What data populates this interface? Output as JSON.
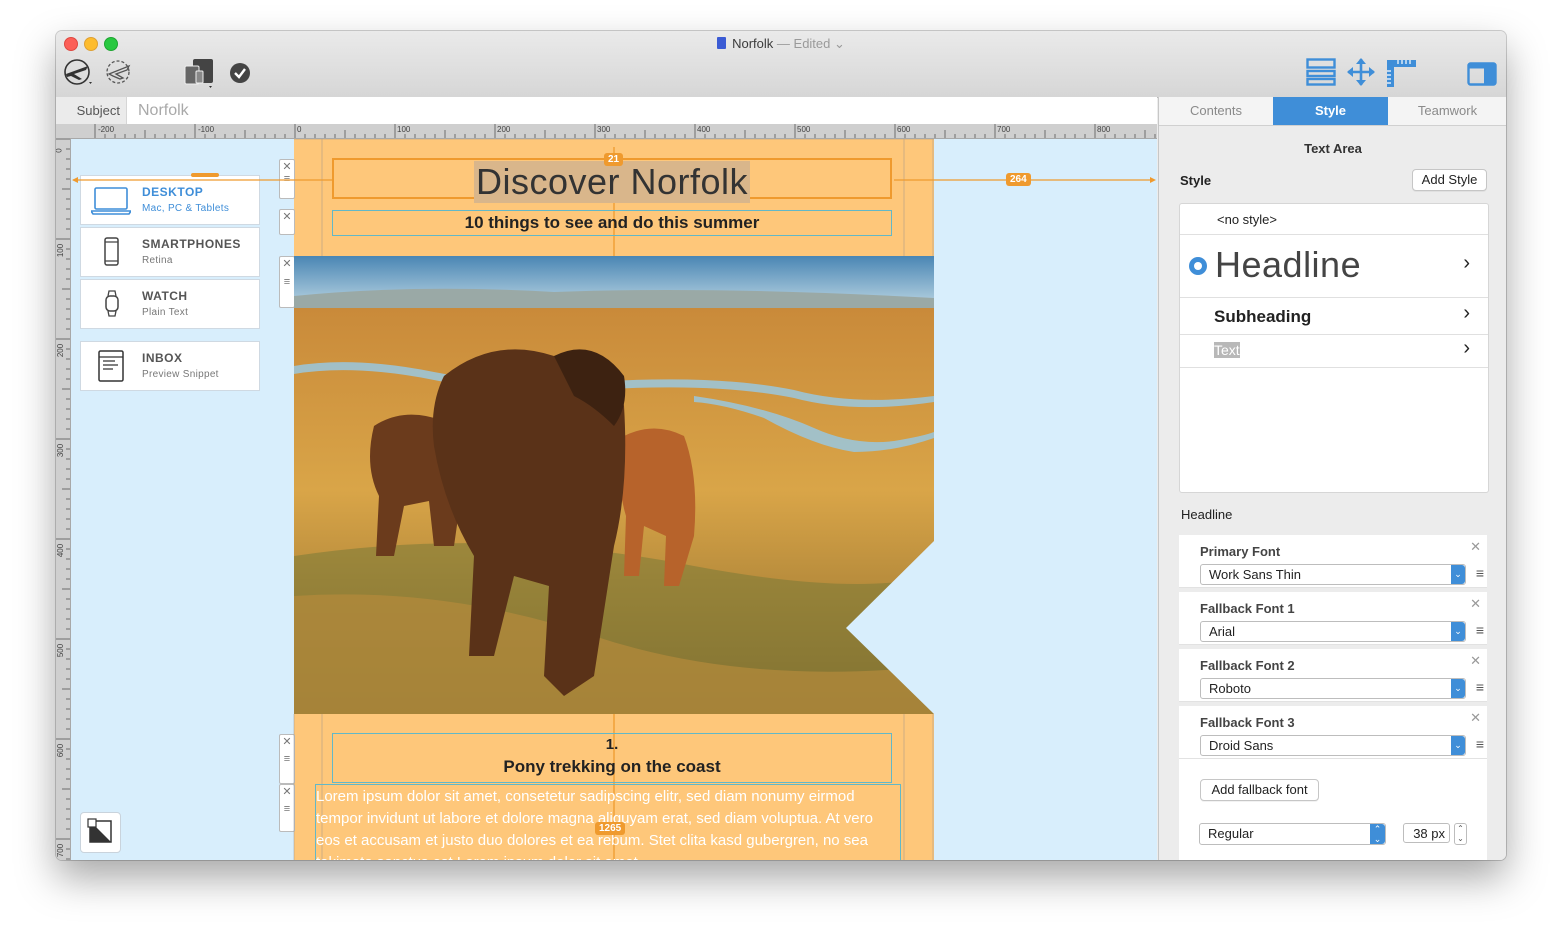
{
  "window": {
    "title": "Norfolk",
    "edited": "— Edited",
    "toolbar_icons": [
      "plane-test-icon",
      "plane-send-icon",
      "devices-icon",
      "checkmark-icon",
      "layout-icon",
      "move-icon",
      "ruler-icon",
      "sidebar-toggle-icon"
    ]
  },
  "subject": {
    "label": "Subject",
    "value": "Norfolk"
  },
  "ruler": {
    "h_ticks": [
      "-200",
      "-100",
      "0",
      "100",
      "200",
      "300",
      "400",
      "500",
      "600",
      "700",
      "800"
    ],
    "v_ticks": [
      "0",
      "100",
      "200",
      "300",
      "400",
      "500",
      "600",
      "700"
    ]
  },
  "devices": [
    {
      "name": "DESKTOP",
      "sub": "Mac, PC & Tablets",
      "icon": "laptop-icon"
    },
    {
      "name": "SMARTPHONES",
      "sub": "Retina",
      "icon": "smartphone-icon"
    },
    {
      "name": "WATCH",
      "sub": "Plain Text",
      "icon": "watch-icon"
    },
    {
      "name": "INBOX",
      "sub": "Preview Snippet",
      "icon": "inbox-icon"
    }
  ],
  "email": {
    "headline": "Discover Norfolk",
    "subheadline": "10 things to see and do this summer",
    "section1_number": "1.",
    "section1_title": "Pony trekking on the coast",
    "body": "Lorem ipsum dolor sit amet, consetetur sadipscing elitr, sed diam nonumy eirmod tempor invidunt ut labore et dolore magna aliquyam erat, sed diam voluptua. At vero eos et accusam et justo duo dolores et ea rebum. Stet clita kasd gubergren, no sea takimata sanctus est Lorem ipsum dolor sit amet.",
    "measure_top": "21",
    "measure_right": "264",
    "measure_bottom": "1265"
  },
  "panel": {
    "tabs": [
      "Contents",
      "Style",
      "Teamwork"
    ],
    "active_tab": "Style",
    "section_title": "Text Area",
    "style_label": "Style",
    "add_style": "Add Style",
    "styles": {
      "none": "<no style>",
      "headline": "Headline",
      "subheading": "Subheading",
      "text": "Text"
    },
    "headline_label": "Headline",
    "fonts": [
      {
        "label": "Primary Font",
        "value": "Work Sans Thin"
      },
      {
        "label": "Fallback Font 1",
        "value": "Arial"
      },
      {
        "label": "Fallback Font 2",
        "value": "Roboto"
      },
      {
        "label": "Fallback Font 3",
        "value": "Droid Sans"
      }
    ],
    "add_fallback": "Add fallback font",
    "weight": "Regular",
    "size": "38 px"
  },
  "colors": {
    "accent": "#3f8ed8",
    "email_bg": "#fec77a",
    "guide": "#ef9a2e",
    "canvas": "#d8eefc"
  }
}
